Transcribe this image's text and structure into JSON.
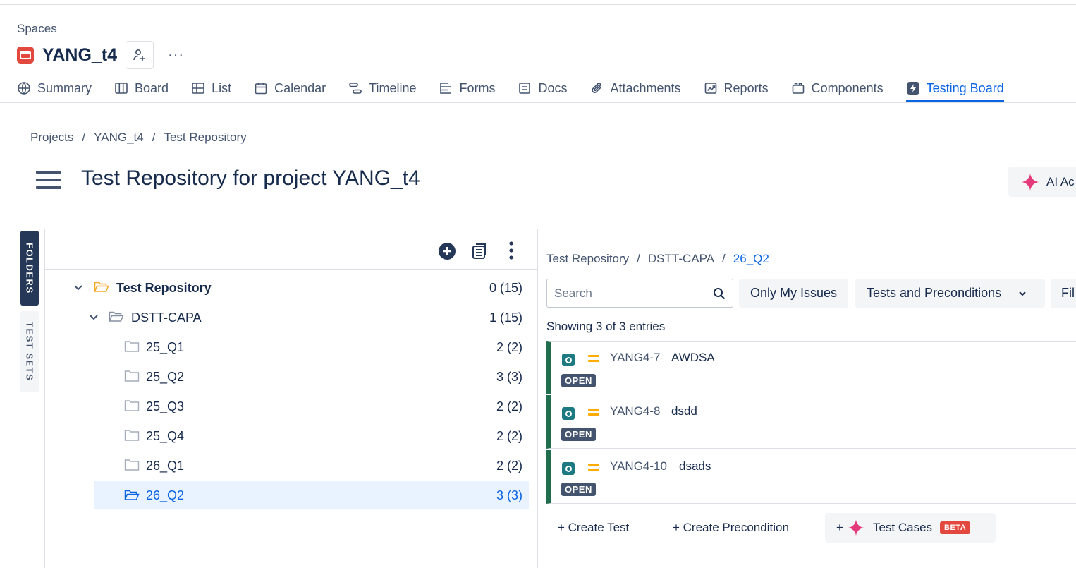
{
  "header": {
    "spaces_label": "Spaces",
    "project_name": "YANG_t4",
    "more_label": "···"
  },
  "nav": {
    "tabs": [
      {
        "label": "Summary",
        "icon": "globe-icon"
      },
      {
        "label": "Board",
        "icon": "board-icon"
      },
      {
        "label": "List",
        "icon": "list-icon"
      },
      {
        "label": "Calendar",
        "icon": "calendar-icon"
      },
      {
        "label": "Timeline",
        "icon": "timeline-icon"
      },
      {
        "label": "Forms",
        "icon": "forms-icon"
      },
      {
        "label": "Docs",
        "icon": "docs-icon"
      },
      {
        "label": "Attachments",
        "icon": "paperclip-icon"
      },
      {
        "label": "Reports",
        "icon": "chart-icon"
      },
      {
        "label": "Components",
        "icon": "components-icon"
      },
      {
        "label": "Testing Board",
        "icon": "lightning-icon",
        "active": true
      }
    ]
  },
  "breadcrumb": {
    "items": [
      "Projects",
      "YANG_t4",
      "Test Repository"
    ],
    "separator": "/"
  },
  "page": {
    "title": "Test Repository for project YANG_t4",
    "ai_button": "AI Ac"
  },
  "side_tabs": {
    "folders": "FOLDERS",
    "test_sets": "TEST SETS"
  },
  "tree": {
    "rows": [
      {
        "label": "Test Repository",
        "count": "0 (15)",
        "level": 0,
        "expanded": true,
        "bold": true
      },
      {
        "label": "DSTT-CAPA",
        "count": "1 (15)",
        "level": 1,
        "expanded": true
      },
      {
        "label": "25_Q1",
        "count": "2 (2)",
        "level": 2
      },
      {
        "label": "25_Q2",
        "count": "3 (3)",
        "level": 2
      },
      {
        "label": "25_Q3",
        "count": "2 (2)",
        "level": 2
      },
      {
        "label": "25_Q4",
        "count": "2 (2)",
        "level": 2
      },
      {
        "label": "26_Q1",
        "count": "2 (2)",
        "level": 2
      },
      {
        "label": "26_Q2",
        "count": "3 (3)",
        "level": 2,
        "selected": true
      }
    ]
  },
  "right": {
    "breadcrumb": [
      "Test Repository",
      "DSTT-CAPA",
      "26_Q2"
    ],
    "search_placeholder": "Search",
    "filter_my_issues": "Only My Issues",
    "filter_type": "Tests and Preconditions",
    "filter_more": "Fil",
    "showing": "Showing 3 of 3 entries",
    "issues": [
      {
        "key": "YANG4-7",
        "summary": "AWDSA",
        "status": "OPEN"
      },
      {
        "key": "YANG4-8",
        "summary": "dsdd",
        "status": "OPEN"
      },
      {
        "key": "YANG4-10",
        "summary": "dsads",
        "status": "OPEN"
      }
    ],
    "actions": {
      "create_test": "+ Create Test",
      "create_precondition": "+ Create Precondition",
      "test_cases_plus": "+",
      "test_cases": "Test Cases",
      "beta": "BETA"
    }
  },
  "colors": {
    "accent": "#0c66e4",
    "status_bar": "#216e4e",
    "project_icon": "#e2483d",
    "ai_sparkle": "#e4397a"
  }
}
